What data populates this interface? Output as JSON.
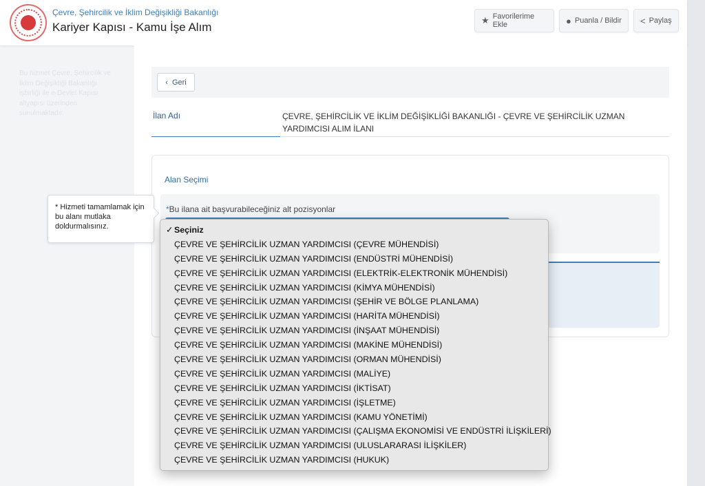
{
  "header": {
    "ministry": "Çevre, Şehircilik ve İklim Değişikliği Bakanlığı",
    "title": "Kariyer Kapısı - Kamu İşe Alım",
    "buttons": {
      "favorites": "Favorilerime Ekle",
      "rate": "Puanla / Bildir",
      "share": "Paylaş"
    }
  },
  "sidebar": {
    "note": "Bu hizmet Çevre, Şehircilik ve İklim Değişikliği Bakanlığı işbirliği ile e-Devlet Kapısı altyapısı üzerinden sunulmaktadır."
  },
  "main": {
    "back_label": "Geri",
    "ilan_label": "İlan Adı",
    "ilan_value": "ÇEVRE, ŞEHİRCİLİK VE İKLİM DEĞİŞİKLİĞİ BAKANLIĞI - ÇEVRE VE ŞEHİRCİLİK UZMAN YARDIMCISI ALIM İLANI",
    "section_title": "Alan Seçimi",
    "field_required_mark": "*",
    "field_label": "Bu ilana ait başvurabileceğiniz alt pozisyonlar"
  },
  "tooltip": {
    "icon": "*",
    "text": "Hizmeti tamamlamak için bu alanı mutlaka doldurmalısınız."
  },
  "dropdown": {
    "selected": "Seçiniz",
    "options": [
      "Seçiniz",
      "ÇEVRE VE ŞEHİRCİLİK UZMAN YARDIMCISI (ÇEVRE MÜHENDİSİ)",
      "ÇEVRE VE ŞEHİRCİLİK UZMAN YARDIMCISI (ENDÜSTRİ MÜHENDİSİ)",
      "ÇEVRE VE ŞEHİRCİLİK UZMAN YARDIMCISI (ELEKTRİK-ELEKTRONİK MÜHENDİSİ)",
      "ÇEVRE VE ŞEHİRCİLİK UZMAN YARDIMCISI (KİMYA MÜHENDİSİ)",
      "ÇEVRE VE ŞEHİRCİLİK UZMAN YARDIMCISI (ŞEHİR VE BÖLGE PLANLAMA)",
      "ÇEVRE VE ŞEHİRCİLİK UZMAN YARDIMCISI (HARİTA MÜHENDİSİ)",
      "ÇEVRE VE ŞEHİRCİLİK UZMAN YARDIMCISI (İNŞAAT MÜHENDİSİ)",
      "ÇEVRE VE ŞEHİRCİLİK UZMAN YARDIMCISI (MAKİNE MÜHENDİSİ)",
      "ÇEVRE VE ŞEHİRCİLİK UZMAN YARDIMCISI (ORMAN MÜHENDİSİ)",
      "ÇEVRE VE ŞEHİRCİLİK UZMAN YARDIMCISI (MALİYE)",
      "ÇEVRE VE ŞEHİRCİLİK UZMAN YARDIMCISI (İKTİSAT)",
      "ÇEVRE VE ŞEHİRCİLİK UZMAN YARDIMCISI (İŞLETME)",
      "ÇEVRE VE ŞEHİRCİLİK UZMAN YARDIMCISI (KAMU YÖNETİMİ)",
      "ÇEVRE VE ŞEHİRCİLİK UZMAN YARDIMCISI (ÇALIŞMA EKONOMİSİ VE ENDÜSTRİ İLİŞKİLERİ)",
      "ÇEVRE VE ŞEHİRCİLİK UZMAN YARDIMCISI (ULUSLARARASI İLİŞKİLER)",
      "ÇEVRE VE ŞEHİRCİLİK UZMAN YARDIMCISI (HUKUK)"
    ]
  },
  "colors": {
    "accent": "#3f7fb8",
    "link": "#2d5f8f",
    "logo_red": "#d63a3a"
  },
  "icons": {
    "favorites": "star-icon",
    "rate": "speech-bubble-icon",
    "share": "share-icon",
    "back": "chevron-left-icon",
    "check": "checkmark-icon"
  }
}
